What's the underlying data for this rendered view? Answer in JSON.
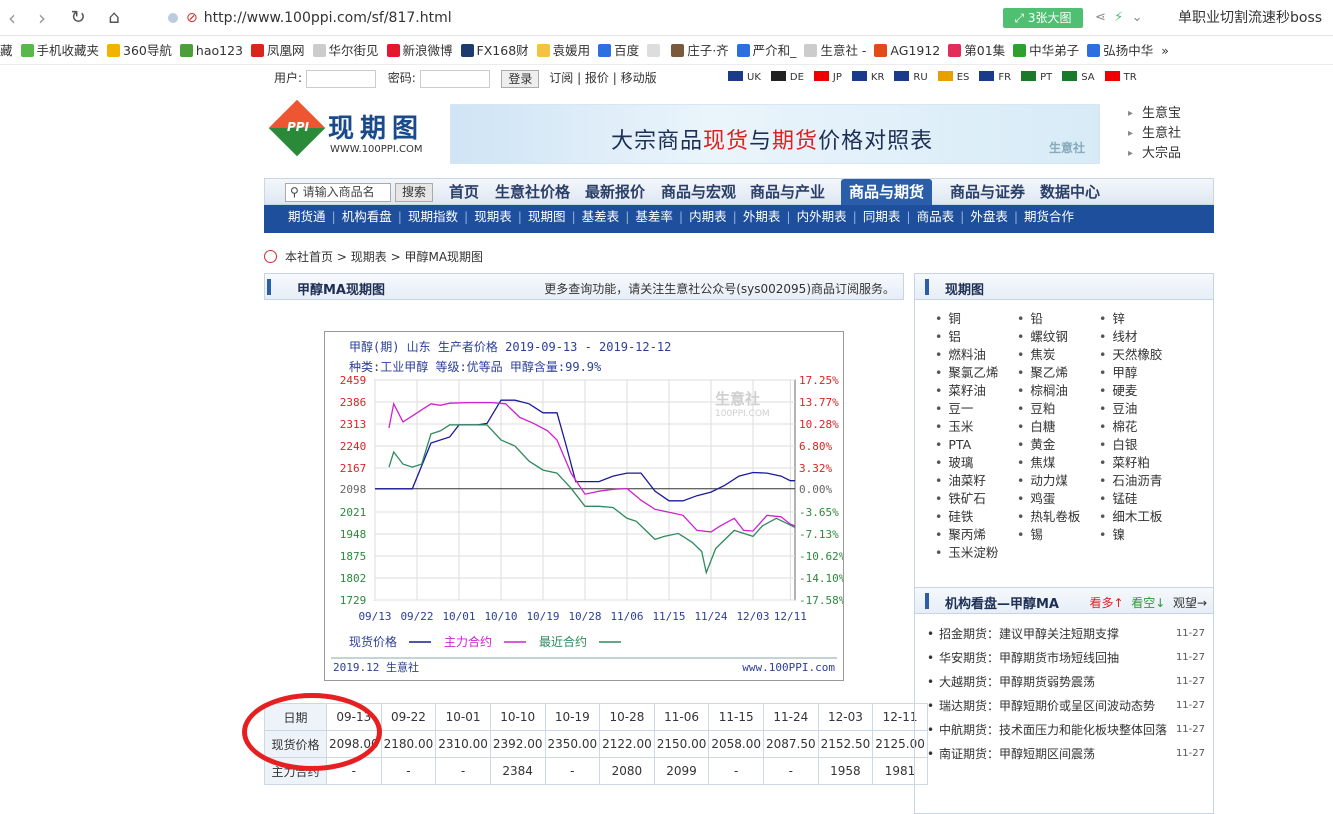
{
  "browser": {
    "url": "http://www.100ppi.com/sf/817.html",
    "ext_button": "3张大图",
    "search_side": "单职业切割流速秒boss"
  },
  "bookmarks": [
    {
      "label": "藏",
      "color": "#fff"
    },
    {
      "label": "手机收藏夹",
      "color": "#59b84a"
    },
    {
      "label": "360导航",
      "color": "#f2b300"
    },
    {
      "label": "hao123",
      "color": "#4c9e3a"
    },
    {
      "label": "凤凰网",
      "color": "#d8261d"
    },
    {
      "label": "华尔街见",
      "color": "#ccc"
    },
    {
      "label": "新浪微博",
      "color": "#e6162d"
    },
    {
      "label": "FX168财",
      "color": "#1d3b6d"
    },
    {
      "label": "袁媛用",
      "color": "#f5c242"
    },
    {
      "label": "百度",
      "color": "#2d6fe0"
    },
    {
      "label": "",
      "color": "#ddd"
    },
    {
      "label": "庄子·齐",
      "color": "#7a5a3a"
    },
    {
      "label": "严介和_",
      "color": "#2d6fe0"
    },
    {
      "label": "生意社 -",
      "color": "#ccc"
    },
    {
      "label": "AG1912",
      "color": "#e24a1a"
    },
    {
      "label": "第01集",
      "color": "#e22d5a"
    },
    {
      "label": "中华弟子",
      "color": "#2da02d"
    },
    {
      "label": "弘扬中华",
      "color": "#2d6fe0"
    },
    {
      "label": "»",
      "color": "#fff"
    }
  ],
  "login": {
    "user_label": "用户:",
    "pass_label": "密码:",
    "login_btn": "登录",
    "links": "订阅 | 报价 | 移动版"
  },
  "flags": [
    {
      "code": "UK",
      "color": "#1a3a8a"
    },
    {
      "code": "DE",
      "color": "#222"
    },
    {
      "code": "JP",
      "color": "#e00"
    },
    {
      "code": "KR",
      "color": "#1a3a8a"
    },
    {
      "code": "RU",
      "color": "#1a3a8a"
    },
    {
      "code": "ES",
      "color": "#e6a000"
    },
    {
      "code": "FR",
      "color": "#1a3a8a"
    },
    {
      "code": "PT",
      "color": "#1a7a2a"
    },
    {
      "code": "SA",
      "color": "#1a7a2a"
    },
    {
      "code": "TR",
      "color": "#e00"
    }
  ],
  "logo": {
    "mark": "PPI",
    "cn": "现期图",
    "en": "WWW.100PPI.COM"
  },
  "banner": {
    "t1": "大宗商品",
    "t2": "现货",
    "t3": "与",
    "t4": "期货",
    "t5": "价格对照表",
    "logo": "生意社"
  },
  "side_links": [
    "生意宝",
    "生意社",
    "大宗品"
  ],
  "main_nav": {
    "search_placeholder": "请输入商品名",
    "search_btn": "搜索",
    "items": [
      "首页",
      "生意社价格",
      "最新报价",
      "商品与宏观",
      "商品与产业",
      "商品与期货",
      "商品与证券",
      "数据中心"
    ]
  },
  "sub_nav": [
    "期货通",
    "机构看盘",
    "现期指数",
    "现期表",
    "现期图",
    "基差表",
    "基差率",
    "内期表",
    "外期表",
    "内外期表",
    "同期表",
    "商品表",
    "外盘表",
    "期货合作"
  ],
  "breadcrumb": [
    "本社首页",
    ">",
    "现期表",
    ">",
    "甲醇MA现期图"
  ],
  "chart_panel": {
    "title": "甲醇MA现期图",
    "note": "更多查询功能，请关注生意社公众号(sys002095)商品订阅服务。"
  },
  "chart_data": {
    "type": "line",
    "title": "甲醇(期) 山东 生产者价格 2019-09-13 - 2019-12-12",
    "subtitle": "种类:工业甲醇  等级:优等品  甲醇含量:99.9%",
    "watermark": "生意社",
    "watermark_sub": "100PPI.COM",
    "ylim": [
      1729,
      2459
    ],
    "y_ticks_left": [
      2459,
      2386,
      2313,
      2240,
      2167,
      2098,
      2021,
      1948,
      1875,
      1802,
      1729
    ],
    "y_ticks_right": [
      "17.25%",
      "13.77%",
      "10.28%",
      "6.80%",
      "3.32%",
      "0.00%",
      "-3.65%",
      "-7.13%",
      "-10.62%",
      "-14.10%",
      "-17.58%"
    ],
    "x_ticks": [
      "09/13",
      "09/22",
      "10/01",
      "10/10",
      "10/19",
      "10/28",
      "11/06",
      "11/15",
      "11/24",
      "12/03",
      "12/11"
    ],
    "x_days": [
      0,
      9,
      18,
      27,
      36,
      45,
      54,
      63,
      72,
      81,
      89
    ],
    "x_span": 90,
    "series": [
      {
        "name": "现货价格",
        "color": "#1a1a9a",
        "points": [
          [
            0,
            2098
          ],
          [
            5,
            2098
          ],
          [
            8,
            2098
          ],
          [
            12,
            2250
          ],
          [
            16,
            2270
          ],
          [
            18,
            2310
          ],
          [
            22,
            2310
          ],
          [
            24,
            2315
          ],
          [
            27,
            2392
          ],
          [
            30,
            2392
          ],
          [
            33,
            2380
          ],
          [
            36,
            2350
          ],
          [
            39,
            2350
          ],
          [
            41,
            2240
          ],
          [
            43,
            2122
          ],
          [
            45,
            2122
          ],
          [
            48,
            2122
          ],
          [
            51,
            2140
          ],
          [
            54,
            2150
          ],
          [
            57,
            2150
          ],
          [
            60,
            2090
          ],
          [
            63,
            2058
          ],
          [
            66,
            2058
          ],
          [
            69,
            2075
          ],
          [
            72,
            2087
          ],
          [
            75,
            2110
          ],
          [
            78,
            2140
          ],
          [
            81,
            2152
          ],
          [
            84,
            2150
          ],
          [
            87,
            2140
          ],
          [
            89,
            2125
          ],
          [
            90,
            2125
          ]
        ]
      },
      {
        "name": "主力合约",
        "color": "#d020d0",
        "points": [
          [
            3,
            2300
          ],
          [
            4,
            2380
          ],
          [
            6,
            2320
          ],
          [
            8,
            2340
          ],
          [
            10,
            2360
          ],
          [
            12,
            2380
          ],
          [
            14,
            2375
          ],
          [
            16,
            2382
          ],
          [
            20,
            2384
          ],
          [
            25,
            2384
          ],
          [
            28,
            2380
          ],
          [
            31,
            2335
          ],
          [
            34,
            2315
          ],
          [
            37,
            2290
          ],
          [
            39,
            2260
          ],
          [
            42,
            2150
          ],
          [
            45,
            2080
          ],
          [
            48,
            2090
          ],
          [
            51,
            2096
          ],
          [
            54,
            2099
          ],
          [
            57,
            2060
          ],
          [
            60,
            2030
          ],
          [
            63,
            2020
          ],
          [
            66,
            2010
          ],
          [
            69,
            1960
          ],
          [
            72,
            1955
          ],
          [
            74,
            1975
          ],
          [
            77,
            2000
          ],
          [
            79,
            1960
          ],
          [
            81,
            1958
          ],
          [
            84,
            2010
          ],
          [
            87,
            2005
          ],
          [
            89,
            1981
          ],
          [
            90,
            1975
          ]
        ]
      },
      {
        "name": "最近合约",
        "color": "#2e8a5e",
        "points": [
          [
            3,
            2170
          ],
          [
            4,
            2220
          ],
          [
            6,
            2180
          ],
          [
            8,
            2170
          ],
          [
            10,
            2180
          ],
          [
            12,
            2280
          ],
          [
            14,
            2290
          ],
          [
            16,
            2310
          ],
          [
            19,
            2310
          ],
          [
            24,
            2310
          ],
          [
            27,
            2260
          ],
          [
            30,
            2240
          ],
          [
            33,
            2190
          ],
          [
            36,
            2160
          ],
          [
            39,
            2150
          ],
          [
            42,
            2100
          ],
          [
            45,
            2040
          ],
          [
            48,
            2040
          ],
          [
            51,
            2036
          ],
          [
            54,
            2000
          ],
          [
            56,
            1990
          ],
          [
            58,
            1960
          ],
          [
            60,
            1930
          ],
          [
            62,
            1940
          ],
          [
            65,
            1950
          ],
          [
            68,
            1920
          ],
          [
            70,
            1890
          ],
          [
            71,
            1820
          ],
          [
            73,
            1900
          ],
          [
            75,
            1930
          ],
          [
            77,
            1960
          ],
          [
            79,
            1950
          ],
          [
            81,
            1940
          ],
          [
            83,
            1975
          ],
          [
            86,
            2000
          ],
          [
            88,
            1985
          ],
          [
            90,
            1970
          ]
        ]
      }
    ],
    "legend": [
      {
        "name": "现货价格",
        "color": "#1a1a9a"
      },
      {
        "name": "主力合约",
        "color": "#d020d0"
      },
      {
        "name": "最近合约",
        "color": "#2e8a5e"
      }
    ],
    "footer_left": "2019.12 生意社",
    "footer_right": "www.100PPI.com"
  },
  "table": {
    "row1_label": "日期",
    "dates": [
      "09-13",
      "09-22",
      "10-01",
      "10-10",
      "10-19",
      "10-28",
      "11-06",
      "11-15",
      "11-24",
      "12-03",
      "12-11"
    ],
    "row2_label": "现货价格",
    "spot": [
      "2098.00",
      "2180.00",
      "2310.00",
      "2392.00",
      "2350.00",
      "2122.00",
      "2150.00",
      "2058.00",
      "2087.50",
      "2152.50",
      "2125.00"
    ],
    "row3_label": "主力合约",
    "main": [
      "-",
      "-",
      "-",
      "2384",
      "-",
      "2080",
      "2099",
      "-",
      "-",
      "1958",
      "1981"
    ]
  },
  "right": {
    "commod_title": "现期图",
    "commodities": [
      [
        "铜",
        "铅",
        "锌"
      ],
      [
        "铝",
        "螺纹钢",
        "线材"
      ],
      [
        "燃料油",
        "焦炭",
        "天然橡胶"
      ],
      [
        "聚氯乙烯",
        "聚乙烯",
        "甲醇"
      ],
      [
        "菜籽油",
        "棕榈油",
        "硬麦"
      ],
      [
        "豆一",
        "豆粕",
        "豆油"
      ],
      [
        "玉米",
        "白糖",
        "棉花"
      ],
      [
        "PTA",
        "黄金",
        "白银"
      ],
      [
        "玻璃",
        "焦煤",
        "菜籽粕"
      ],
      [
        "油菜籽",
        "动力煤",
        "石油沥青"
      ],
      [
        "铁矿石",
        "鸡蛋",
        "锰硅"
      ],
      [
        "硅铁",
        "热轧卷板",
        "细木工板"
      ],
      [
        "聚丙烯",
        "锡",
        "镍"
      ],
      [
        "玉米淀粉",
        "",
        ""
      ]
    ],
    "inst_title": "机构看盘—甲醇MA",
    "inst_bull": "看多↑",
    "inst_bear": "看空↓",
    "inst_watch": "观望→",
    "inst_items": [
      {
        "text": "招金期货：建议甲醇关注短期支撑",
        "date": "11-27"
      },
      {
        "text": "华安期货：甲醇期货市场短线回抽",
        "date": "11-27"
      },
      {
        "text": "大越期货：甲醇期货弱势震荡",
        "date": "11-27"
      },
      {
        "text": "瑞达期货：甲醇短期价或呈区间波动态势",
        "date": "11-27"
      },
      {
        "text": "中航期货：技术面压力和能化板块整体回落",
        "date": "11-27"
      },
      {
        "text": "南证期货：甲醇短期区间震荡",
        "date": "11-27"
      }
    ]
  }
}
